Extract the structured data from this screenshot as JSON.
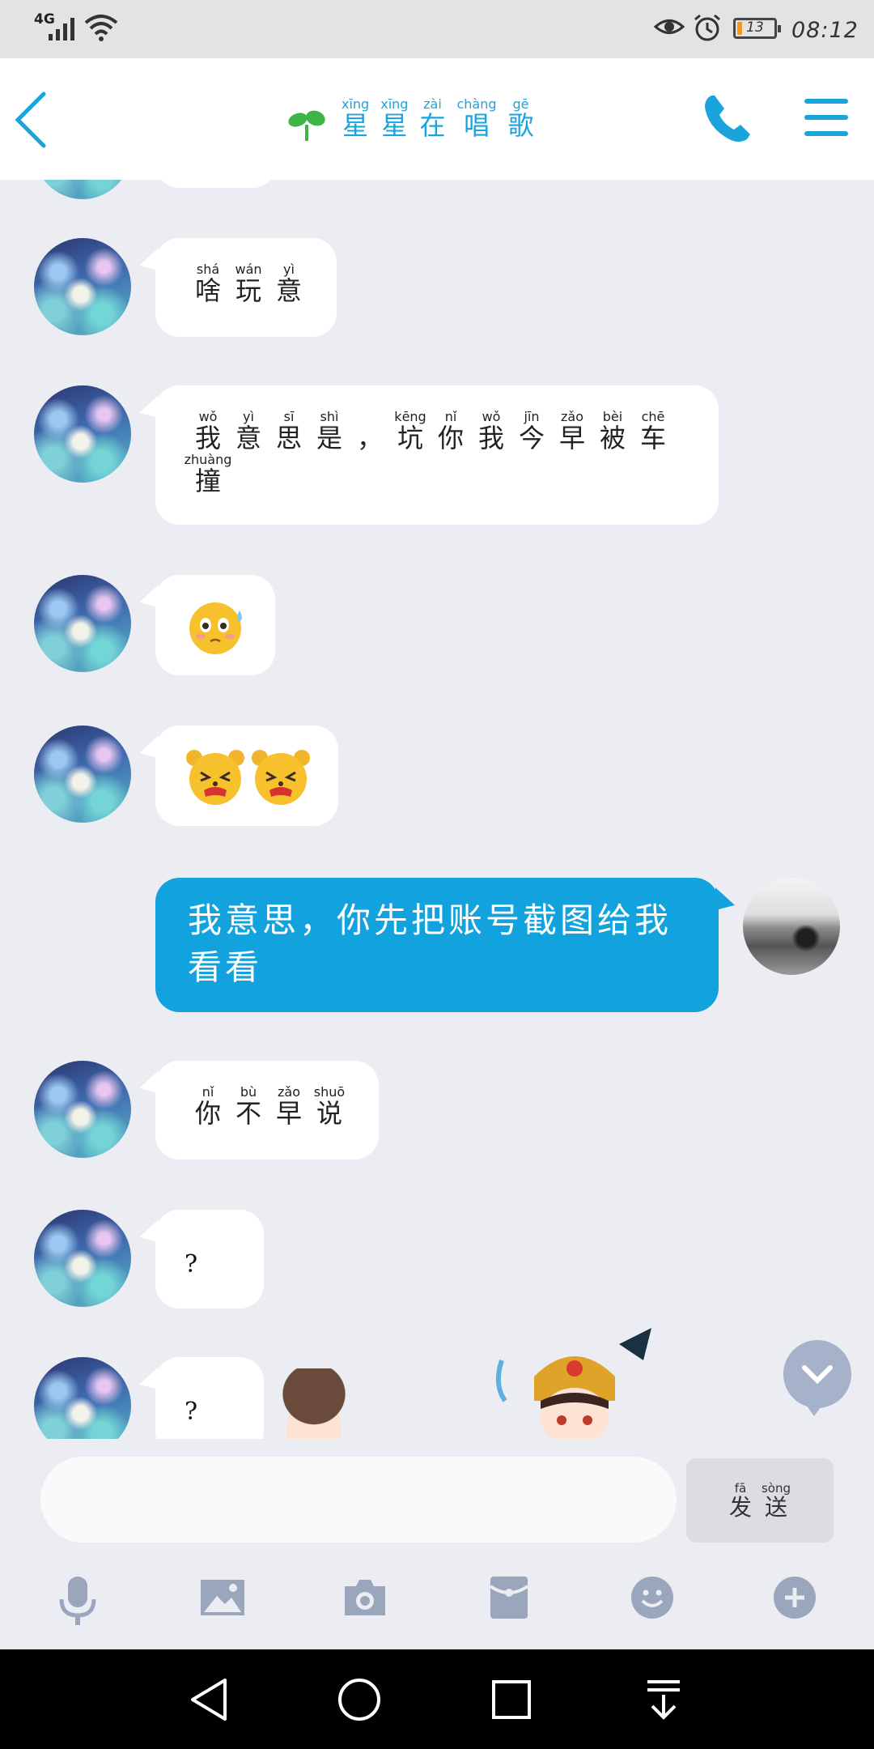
{
  "status_bar": {
    "network": "4G",
    "battery": "13",
    "battery_level": 0.13,
    "time": "08:12",
    "icons": [
      "signal-icon",
      "wifi-icon",
      "eye-icon",
      "alarm-icon",
      "battery-icon"
    ]
  },
  "header": {
    "title": [
      {
        "py": "xīng",
        "hz": "星"
      },
      {
        "py": "xīng",
        "hz": "星"
      },
      {
        "py": "zài",
        "hz": "在"
      },
      {
        "py": "chàng",
        "hz": "唱"
      },
      {
        "py": "gē",
        "hz": "歌"
      }
    ],
    "icons": [
      "back-icon",
      "sprout-icon",
      "phone-icon",
      "menu-icon"
    ],
    "accent": "#1aa4dd"
  },
  "messages": [
    {
      "side": "left",
      "chars": [
        {
          "py": "shá",
          "hz": "啥"
        },
        {
          "py": "wán",
          "hz": "玩"
        },
        {
          "py": "yì",
          "hz": "意"
        }
      ]
    },
    {
      "side": "left",
      "chars": [
        {
          "py": "wǒ",
          "hz": "我"
        },
        {
          "py": "yì",
          "hz": "意"
        },
        {
          "py": "sī",
          "hz": "思"
        },
        {
          "py": "shì",
          "hz": "是"
        },
        {
          "py": "",
          "hz": "，"
        },
        {
          "py": "kēng",
          "hz": "坑"
        },
        {
          "py": "nǐ",
          "hz": "你"
        },
        {
          "py": "wǒ",
          "hz": "我"
        },
        {
          "py": "jīn",
          "hz": "今"
        },
        {
          "py": "zǎo",
          "hz": "早"
        },
        {
          "py": "bèi",
          "hz": "被"
        },
        {
          "py": "chē",
          "hz": "车"
        },
        {
          "py": "zhuàng",
          "hz": "撞"
        }
      ]
    },
    {
      "side": "left",
      "emoji": [
        "pleading-face-emoji"
      ]
    },
    {
      "side": "left",
      "emoji": [
        "crying-bear-emoji",
        "crying-bear-emoji"
      ]
    },
    {
      "side": "right",
      "text": "我意思，你先把账号截图给我看看"
    },
    {
      "side": "left",
      "chars": [
        {
          "py": "nǐ",
          "hz": "你"
        },
        {
          "py": "bù",
          "hz": "不"
        },
        {
          "py": "zǎo",
          "hz": "早"
        },
        {
          "py": "shuō",
          "hz": "说"
        }
      ]
    },
    {
      "side": "left",
      "text": "?"
    },
    {
      "side": "left",
      "text": "?"
    }
  ],
  "input": {
    "value": "",
    "send": [
      {
        "py": "fā",
        "hz": "发"
      },
      {
        "py": "sòng",
        "hz": "送"
      }
    ]
  },
  "toolbar": [
    "microphone-icon",
    "image-icon",
    "camera-icon",
    "red-packet-icon",
    "emoji-icon",
    "plus-icon"
  ],
  "nav": [
    "back-nav-icon",
    "home-nav-icon",
    "recents-nav-icon",
    "notification-pull-icon"
  ],
  "colors": {
    "bubble_mine": "#12a2dd",
    "background": "#ebedf2",
    "tool_icon": "#9aa6bc"
  }
}
